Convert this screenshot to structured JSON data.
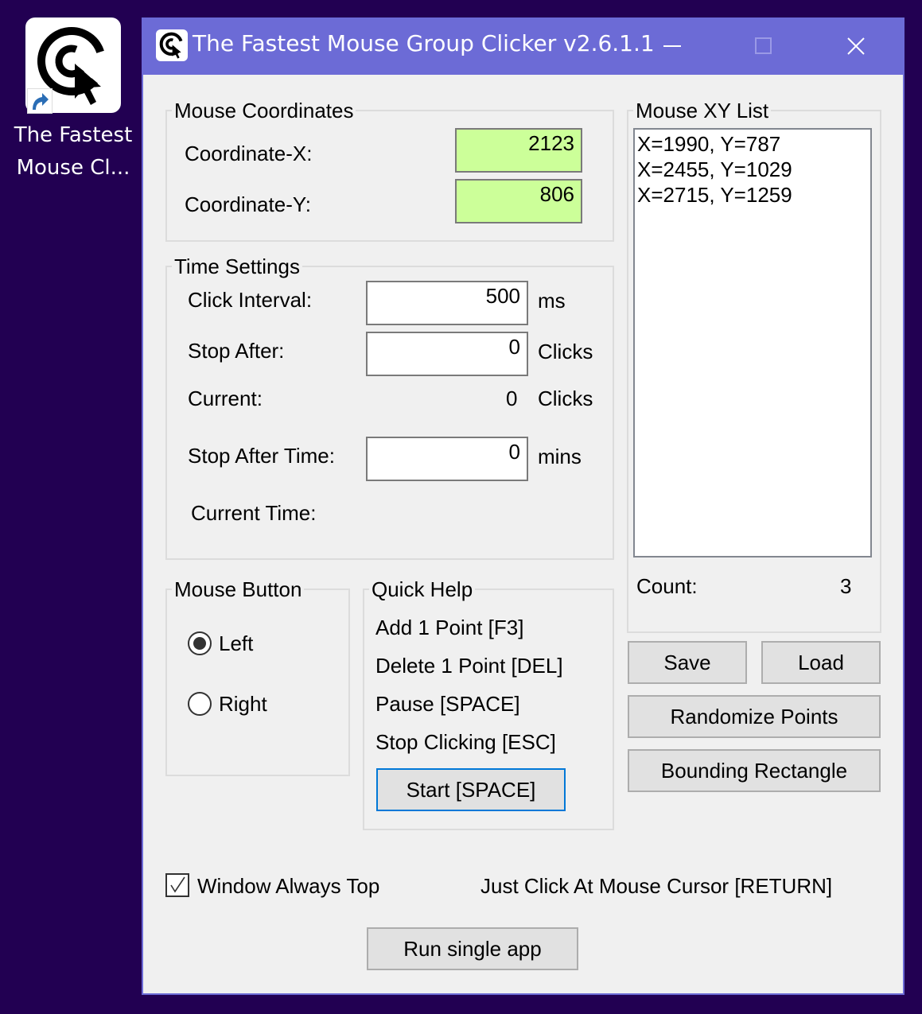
{
  "desktop": {
    "shortcut_label_line1": "The Fastest",
    "shortcut_label_line2": "Mouse Cl..."
  },
  "window": {
    "title": "The Fastest Mouse Group Clicker v2.6.1.1",
    "minimize_glyph": "—",
    "maximize_glyph": "☐",
    "close_glyph": "✕",
    "titlebar_color": "#6c6bd6"
  },
  "mouse_coordinates": {
    "title": "Mouse Coordinates",
    "x_label": "Coordinate-X:",
    "x_value": "2123",
    "y_label": "Coordinate-Y:",
    "y_value": "806",
    "field_color": "#ccff99"
  },
  "time_settings": {
    "title": "Time Settings",
    "click_interval_label": "Click Interval:",
    "click_interval_value": "500",
    "click_interval_unit": "ms",
    "stop_after_label": "Stop After:",
    "stop_after_value": "0",
    "stop_after_unit": "Clicks",
    "current_label": "Current:",
    "current_value": "0",
    "current_unit": "Clicks",
    "stop_after_time_label": "Stop After Time:",
    "stop_after_time_value": "0",
    "stop_after_time_unit": "mins",
    "current_time_label": "Current Time:"
  },
  "mouse_button": {
    "title": "Mouse Button",
    "options": [
      {
        "label": "Left",
        "selected": true
      },
      {
        "label": "Right",
        "selected": false
      }
    ]
  },
  "quick_help": {
    "title": "Quick Help",
    "items": [
      "Add 1 Point [F3]",
      "Delete 1 Point [DEL]",
      "Pause [SPACE]",
      "Stop Clicking [ESC]"
    ],
    "start_button": "Start [SPACE]"
  },
  "xy_list": {
    "title": "Mouse XY List",
    "items": [
      "X=1990, Y=787",
      "X=2455, Y=1029",
      "X=2715, Y=1259"
    ],
    "count_label": "Count:",
    "count_value": "3"
  },
  "buttons": {
    "save": "Save",
    "load": "Load",
    "randomize": "Randomize Points",
    "bounding": "Bounding Rectangle",
    "run_single": "Run single app"
  },
  "footer": {
    "always_top_label": "Window Always Top",
    "always_top_checked": true,
    "just_click_label": "Just Click At Mouse Cursor [RETURN]"
  }
}
